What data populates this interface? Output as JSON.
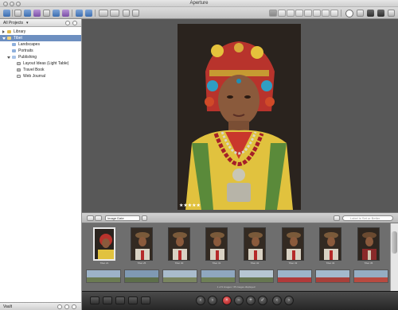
{
  "window": {
    "title": "Aperture"
  },
  "projects_panel": {
    "header": "All Projects",
    "library": "Library",
    "project": "Tibet",
    "items": [
      "Landscapes",
      "Portraits"
    ],
    "publishing": "Publishing",
    "publishing_items": [
      "Layout Ideas (Light Table)",
      "Travel Book",
      "Web Journal"
    ],
    "footer": "Vault"
  },
  "viewer": {
    "rating_stars": "★★★★★",
    "rating": 5
  },
  "browser": {
    "sort_label": "Image Date",
    "search_placeholder": "Label is Set or Better",
    "thumbnails": [
      "Tibet 21",
      "Tibet 25",
      "Tibet 30",
      "Tibet 31",
      "Tibet 32",
      "Tibet 33",
      "Tibet 34",
      "Tibet 35"
    ],
    "status": "1 of 9 images / 35 images displayed"
  },
  "colors": {
    "selection": "#6d8fc0",
    "viewer_bg": "#585858",
    "filmstrip_bg": "#6e6e6e",
    "reject_button": "#b01c1c"
  }
}
